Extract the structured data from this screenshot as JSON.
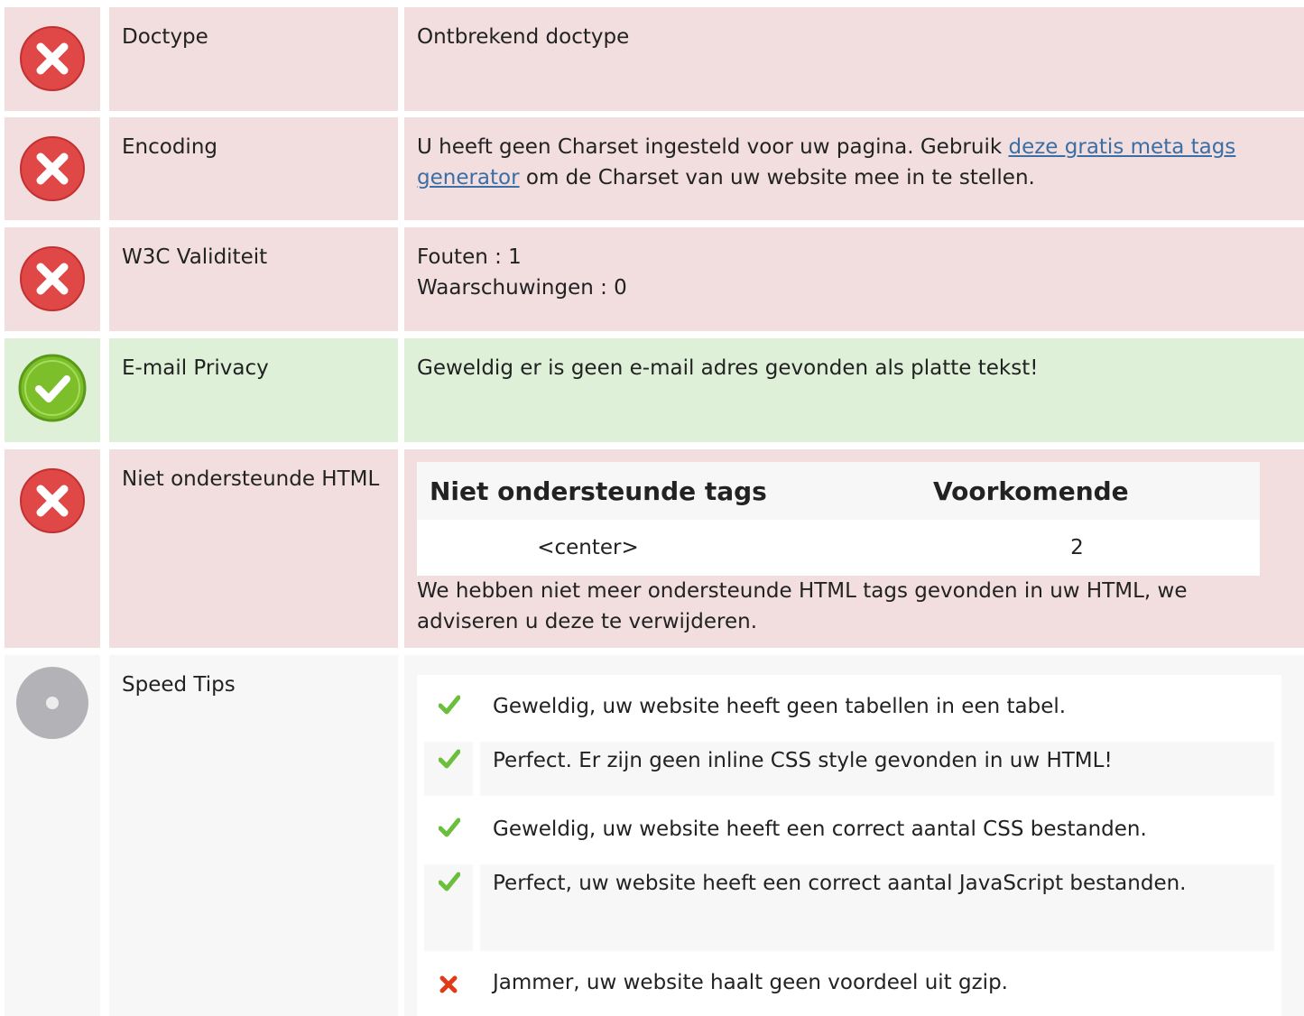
{
  "rows": {
    "doctype": {
      "label": "Doctype",
      "value": "Ontbrekend doctype"
    },
    "encoding": {
      "label": "Encoding",
      "text_before": "U heeft geen Charset ingesteld voor uw pagina. Gebruik ",
      "link": "deze gratis meta tags generator",
      "text_after": " om de Charset van uw website mee in te stellen."
    },
    "w3c": {
      "label": "W3C Validiteit",
      "errors": "Fouten : 1",
      "warnings": "Waarschuwingen : 0"
    },
    "email": {
      "label": "E-mail Privacy",
      "value": "Geweldig er is geen e-mail adres gevonden als platte tekst!"
    },
    "unsupported": {
      "label": "Niet ondersteunde HTML",
      "table_headers": [
        "Niet ondersteunde tags",
        "Voorkomende"
      ],
      "table_rows": [
        {
          "tag": "<center>",
          "count": "2"
        }
      ],
      "note": "We hebben niet meer ondersteunde HTML tags gevonden in uw HTML, we adviseren u deze te verwijderen."
    },
    "speed": {
      "label": "Speed Tips",
      "tips": [
        {
          "status": "ok",
          "text": "Geweldig, uw website heeft geen tabellen in een tabel."
        },
        {
          "status": "ok",
          "text": "Perfect. Er zijn geen inline CSS style gevonden in uw HTML!"
        },
        {
          "status": "ok",
          "text": "Geweldig, uw website heeft een correct aantal CSS bestanden."
        },
        {
          "status": "ok",
          "text": "Perfect, uw website heeft een correct aantal JavaScript bestanden."
        },
        {
          "status": "fail",
          "text": "Jammer, uw website haalt geen voordeel uit gzip."
        }
      ]
    }
  },
  "colors": {
    "error_bg": "#f2dede",
    "success_bg": "#dff0d8",
    "neutral_bg": "#f7f7f7",
    "link": "#3a6ea5",
    "error_icon": "#e04848",
    "success_icon": "#7cbf2a",
    "neutral_icon": "#b3b3b7",
    "check": "#6cbf3c",
    "cross": "#e03a1a"
  }
}
